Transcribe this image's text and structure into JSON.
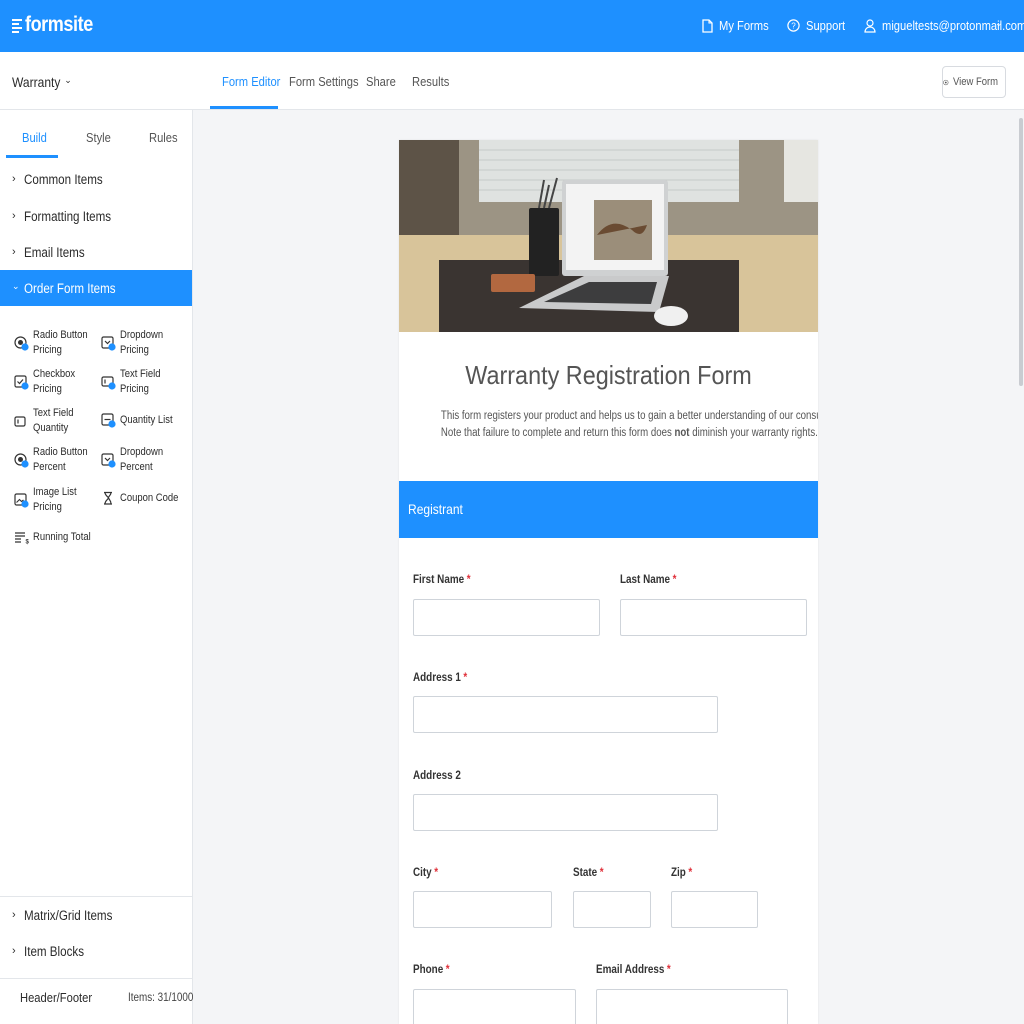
{
  "topbar": {
    "brand": "formsite",
    "my_forms": "My Forms",
    "support": "Support",
    "user": "migueltests@protonmail.com",
    "accent": "#1e90ff"
  },
  "subnav": {
    "form_name": "Warranty",
    "tabs": [
      "Form Editor",
      "Form Settings",
      "Share",
      "Results"
    ],
    "active_tab": "Form Editor",
    "view_form": "View Form"
  },
  "sidebar": {
    "tabs": [
      "Build",
      "Style",
      "Rules"
    ],
    "active_tab": "Build",
    "sections": [
      "Common Items",
      "Formatting Items",
      "Email Items",
      "Order Form Items"
    ],
    "open_section": "Order Form Items",
    "items": [
      {
        "line1": "Radio Button",
        "line2": "Pricing",
        "icon": "radio-pricing-icon"
      },
      {
        "line1": "Dropdown",
        "line2": "Pricing",
        "icon": "dropdown-pricing-icon"
      },
      {
        "line1": "Checkbox",
        "line2": "Pricing",
        "icon": "checkbox-pricing-icon"
      },
      {
        "line1": "Text Field",
        "line2": "Pricing",
        "icon": "textfield-pricing-icon"
      },
      {
        "line1": "Text Field",
        "line2": "Quantity",
        "icon": "textfield-quantity-icon"
      },
      {
        "line1": "Quantity List",
        "line2": "",
        "icon": "quantity-list-icon"
      },
      {
        "line1": "Radio Button",
        "line2": "Percent",
        "icon": "radio-percent-icon"
      },
      {
        "line1": "Dropdown",
        "line2": "Percent",
        "icon": "dropdown-percent-icon"
      },
      {
        "line1": "Image List",
        "line2": "Pricing",
        "icon": "image-list-pricing-icon"
      },
      {
        "line1": "Coupon Code",
        "line2": "",
        "icon": "coupon-code-icon"
      },
      {
        "line1": "Running Total",
        "line2": "",
        "icon": "running-total-icon"
      }
    ],
    "bottom_sections": [
      "Matrix/Grid Items",
      "Item Blocks"
    ],
    "header_footer": "Header/Footer",
    "items_count": "Items: 31/1000"
  },
  "form": {
    "title": "Warranty Registration Form",
    "desc_line1": "This form registers your product and helps us to gain a better understanding of our consumers.",
    "desc_line2_pre": "Note that failure to complete and return this form does ",
    "desc_line2_bold": "not",
    "desc_line2_post": " diminish your warranty rights.",
    "section": "Registrant",
    "required_mark": "*",
    "fields": {
      "first_name": "First Name",
      "last_name": "Last Name",
      "address1": "Address 1",
      "address2": "Address 2",
      "city": "City",
      "state": "State",
      "zip": "Zip",
      "phone": "Phone",
      "email": "Email Address"
    }
  }
}
